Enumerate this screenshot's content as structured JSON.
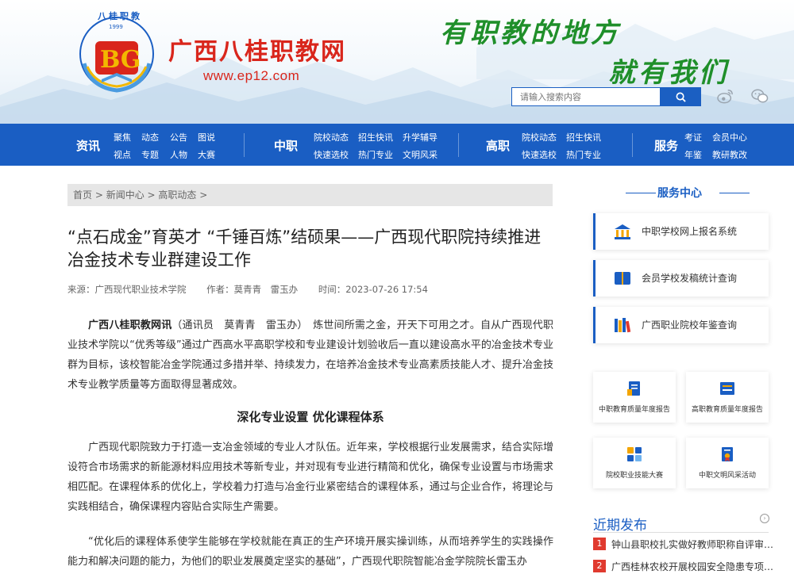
{
  "header": {
    "logo_year": "1999",
    "logo_arc_text": "八桂职教",
    "site_name": "广西八桂职教网",
    "site_url": "www.ep12.com",
    "slogan_line1": "有职教的地方",
    "slogan_line2": "就有我们",
    "search_placeholder": "请输入搜索内容",
    "brand_red": "#d9261c",
    "brand_blue": "#1a5ec3",
    "slogan_green": "#1f8f2a"
  },
  "nav": {
    "groups": [
      {
        "category": "资讯",
        "links": [
          "聚焦",
          "动态",
          "公告",
          "图说",
          "视点",
          "专题",
          "人物",
          "大赛"
        ]
      },
      {
        "category": "中职",
        "links": [
          "院校动态",
          "招生快讯",
          "升学辅导",
          "快速选校",
          "热门专业",
          "文明风采"
        ]
      },
      {
        "category": "高职",
        "links": [
          "院校动态",
          "招生快讯",
          "快速选校",
          "热门专业"
        ]
      },
      {
        "category": "服务",
        "links": [
          "考证",
          "会员中心",
          "年鉴",
          "教研教改"
        ]
      }
    ]
  },
  "breadcrumb": [
    "首页",
    "新闻中心",
    "高职动态"
  ],
  "article": {
    "title": "“点石成金”育英才 “千锤百炼”结硕果——广西现代职院持续推进冶金技术专业群建设工作",
    "source": "来源：广西现代职业技术学院",
    "authors": "作者：莫青青　雷玉办",
    "time": "时间：2023-07-26 17:54",
    "lead_bold": "广西八桂职教网讯",
    "lead_rest": "（通讯员　莫青青　雷玉办）　炼世间所需之金，开天下可用之才。自从广西现代职业技术学院以“优秀等级”通过广西高水平高职学校和专业建设计划验收后一直以建设高水平的冶金技术专业群为目标，该校智能冶金学院通过多措并举、持续发力，在培养冶金技术专业高素质技能人才、提升冶金技术专业教学质量等方面取得显著成效。",
    "section1": "深化专业设置 优化课程体系",
    "para2": "广西现代职院致力于打造一支冶金领域的专业人才队伍。近年来，学校根据行业发展需求，结合实际增设符合市场需求的新能源材料应用技术等新专业，并对现有专业进行精简和优化，确保专业设置与市场需求相匹配。在课程体系的优化上，学校着力打造与冶金行业紧密结合的课程体系，通过与企业合作，将理论与实践相结合，确保课程内容贴合实际生产需要。",
    "para3": "“优化后的课程体系使学生能够在学校就能在真正的生产环境开展实操训练，从而培养学生的实践操作能力和解决问题的能力，为他们的职业发展奠定坚实的基础”，广西现代职院智能冶金学院院长雷玉办"
  },
  "sidebar": {
    "service_title": "服务中心",
    "services": [
      {
        "label": "中职学校网上报名系统",
        "icon": "building-icon"
      },
      {
        "label": "会员学校发稿统计查询",
        "icon": "book-icon"
      },
      {
        "label": "广西职业院校年鉴查询",
        "icon": "books-icon"
      }
    ],
    "tiles": [
      {
        "label": "中职教育质量年度报告",
        "icon": "report-icon"
      },
      {
        "label": "高职教育质量年度报告",
        "icon": "report-board-icon"
      },
      {
        "label": "院校职业技能大赛",
        "icon": "apps-icon"
      },
      {
        "label": "中职文明风采活动",
        "icon": "certificate-icon"
      }
    ],
    "recent_title": "近期发布",
    "recent": [
      {
        "num": "1",
        "title": "钟山县职校扎实做好教师职称自评审核工作"
      },
      {
        "num": "2",
        "title": "广西桂林农校开展校园安全隐患专项排查工作"
      }
    ]
  }
}
